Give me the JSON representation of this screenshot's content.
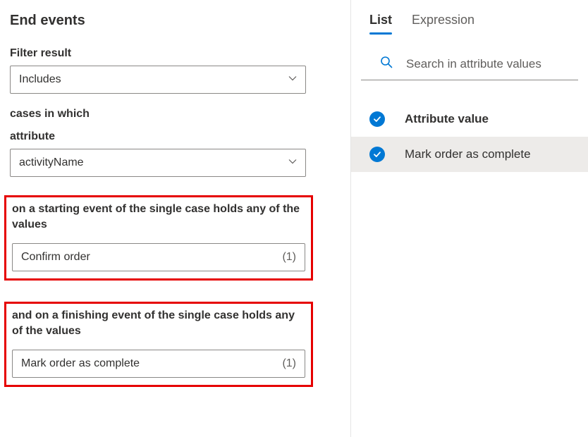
{
  "left": {
    "heading": "End events",
    "filter_label": "Filter result",
    "filter_value": "Includes",
    "cases_label": "cases in which",
    "attribute_label": "attribute",
    "attribute_value": "activityName",
    "start_group": {
      "label": "on a starting event of the single case holds any of the values",
      "value": "Confirm order",
      "count": "(1)"
    },
    "finish_group": {
      "label": "and on a finishing event of the single case holds any of the values",
      "value": "Mark order as complete",
      "count": "(1)"
    }
  },
  "right": {
    "tabs": {
      "list": "List",
      "expression": "Expression"
    },
    "search_placeholder": "Search in attribute values",
    "header_label": "Attribute value",
    "item_label": "Mark order as complete"
  }
}
